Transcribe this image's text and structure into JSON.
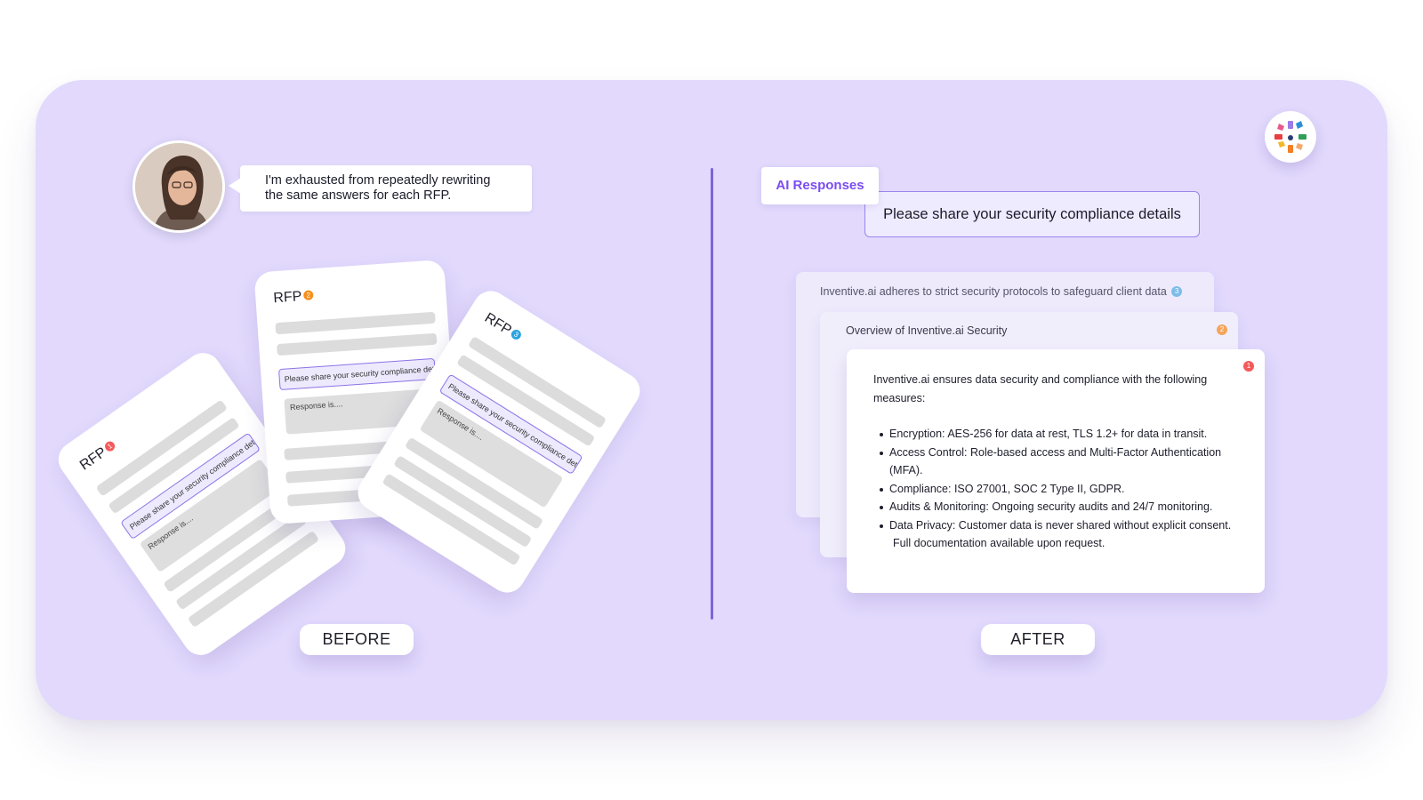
{
  "before": {
    "speech": "I'm exhausted from repeatedly rewriting the same answers for each RFP.",
    "cards": [
      {
        "title": "RFP",
        "badge": "1",
        "badge_color": "#f35a5a",
        "question": "Please share your security compliance details",
        "response": "Response is...."
      },
      {
        "title": "RFP",
        "badge": "2",
        "badge_color": "#f5901e",
        "question": "Please share your security compliance details",
        "response": "Response is...."
      },
      {
        "title": "RFP",
        "badge": "3",
        "badge_color": "#2aa3e0",
        "question": "Please share your security compliance details",
        "response": "Response is...."
      }
    ],
    "label": "BEFORE"
  },
  "after": {
    "tag": "AI Responses",
    "question": "Please share your security compliance details",
    "responses": [
      {
        "heading": "Inventive.ai adheres to strict security protocols to safeguard client data",
        "badge": "3",
        "badge_color": "#7dbde8"
      },
      {
        "heading": "Overview of Inventive.ai Security",
        "badge": "2",
        "badge_color": "#f5a55a"
      },
      {
        "badge": "1",
        "badge_color": "#f35a5a",
        "intro": "Inventive.ai ensures data security and compliance with the following measures:",
        "bullets": [
          "Encryption: AES-256 for data at rest, TLS 1.2+ for data in transit.",
          "Access Control: Role-based access and Multi-Factor Authentication (MFA).",
          "Compliance: ISO 27001, SOC 2 Type II, GDPR.",
          "Audits & Monitoring: Ongoing security audits and 24/7 monitoring.",
          "Data Privacy: Customer data is never shared without explicit consent."
        ],
        "footer": "Full documentation available upon request."
      }
    ],
    "label": "AFTER"
  },
  "colors": {
    "panel": "#e2d9fd",
    "accent": "#7b4cf2",
    "divider": "#7b66d6",
    "question_border": "#9d86ea"
  },
  "icons": {
    "logo": "inventive-pinwheel-logo",
    "avatar": "woman-portrait-avatar"
  }
}
